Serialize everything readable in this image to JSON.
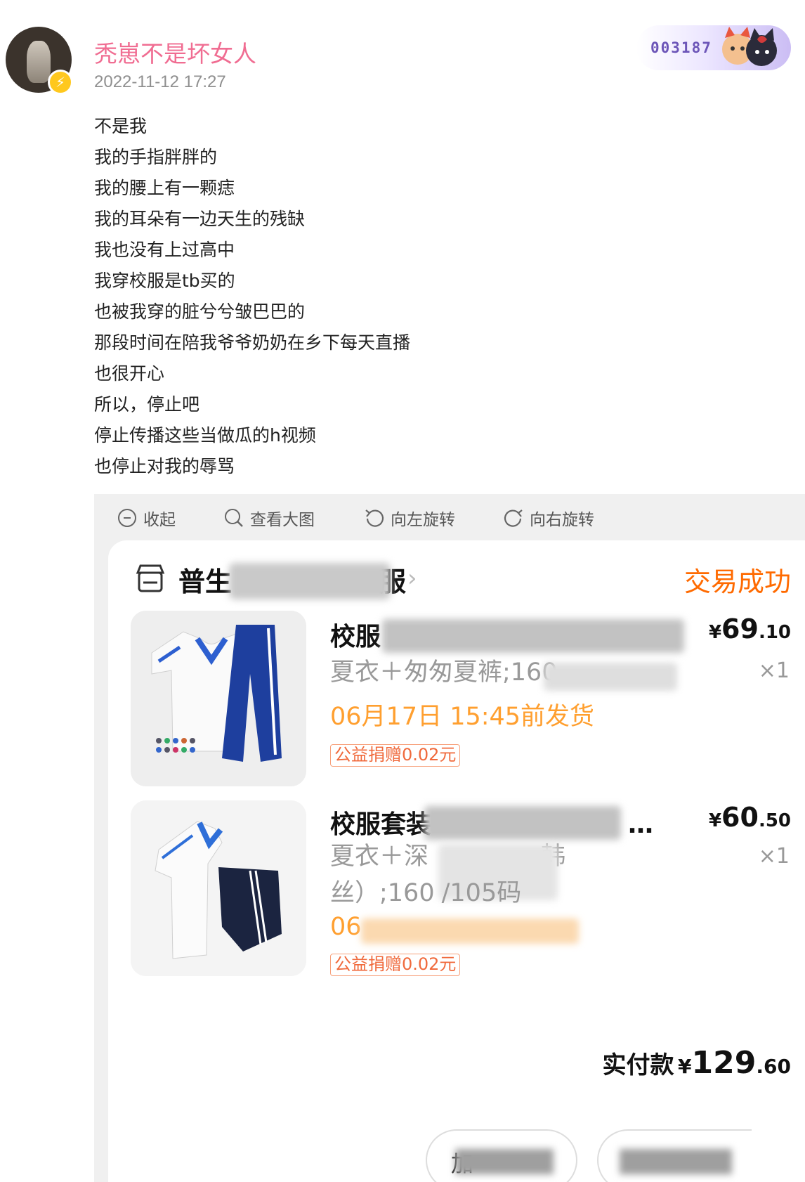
{
  "post": {
    "username": "秃崽不是坏女人",
    "timestamp": "2022-11-12 17:27",
    "fan_badge_number": "003187",
    "lines": [
      "不是我",
      "我的手指胖胖的",
      "我的腰上有一颗痣",
      "我的耳朵有一边天生的残缺",
      "我也没有上过高中",
      "我穿校服是tb买的",
      "也被我穿的脏兮兮皱巴巴的",
      "那段时间在陪我爷爷奶奶在乡下每天直播",
      "也很开心",
      "所以，停止吧",
      "停止传播这些当做瓜的h视频",
      "也停止对我的辱骂"
    ]
  },
  "viewer": {
    "toolbar": {
      "collapse": "收起",
      "view_large": "查看大图",
      "rotate_left": "向左旋转",
      "rotate_right": "向右旋转"
    }
  },
  "order": {
    "shop_name_start": "普生",
    "shop_name_end": "服",
    "status": "交易成功",
    "status_color": "#ff6a00",
    "items": [
      {
        "title": "校服",
        "sku_line1": "夏衣＋匆匆夏裤;160",
        "ship": "06月17日 15:45前发货",
        "donation": "公益捐赠0.02元",
        "price_symbol": "¥",
        "price_int": "69",
        "price_dec": ".10",
        "qty": "×1"
      },
      {
        "title": "校服套装",
        "title_suffix": "…",
        "sku_line1": "夏衣＋深",
        "sku_line1_end": "韩",
        "sku_line2": "丝）;160",
        "sku_line2_end": "/105码",
        "ship": "06",
        "donation": "公益捐赠0.02元",
        "price_symbol": "¥",
        "price_int": "60",
        "price_dec": ".50",
        "qty": "×1"
      }
    ],
    "total_label": "实付款",
    "total_symbol": "¥",
    "total_int": "129",
    "total_dec": ".60",
    "button1_label": "加"
  }
}
